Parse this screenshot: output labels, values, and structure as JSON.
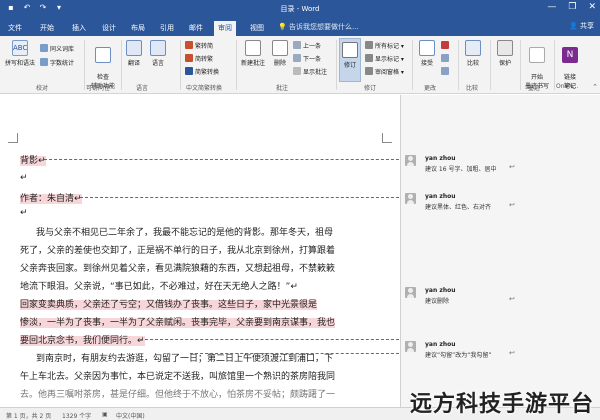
{
  "titlebar": {
    "title": "目录 - Word",
    "controls": [
      "—",
      "❐",
      "✕"
    ]
  },
  "tabs": [
    {
      "label": "文件"
    },
    {
      "label": "开始"
    },
    {
      "label": "插入"
    },
    {
      "label": "设计"
    },
    {
      "label": "布局"
    },
    {
      "label": "引用"
    },
    {
      "label": "邮件"
    },
    {
      "label": "审阅"
    },
    {
      "label": "视图"
    }
  ],
  "tell_me": "告诉我您想要做什么...",
  "share": "共享",
  "ribbon": {
    "proofing": {
      "spelling": "拼写和语法",
      "thesaurus": "同义词库",
      "wordcount": "字数统计",
      "label": "校对"
    },
    "accessibility": {
      "check": "检查\n辅助功能",
      "label": "可访问性"
    },
    "language": {
      "translate": "翻译",
      "language": "语言",
      "label": "语言"
    },
    "chinese": {
      "t2s": "繁转简",
      "s2t": "简转繁",
      "convert": "简繁转换",
      "label": "中文简繁转换"
    },
    "comments": {
      "new": "新建批注",
      "delete": "删除",
      "prev": "上一条",
      "next": "下一条",
      "show": "显示批注",
      "label": "批注"
    },
    "tracking": {
      "track": "修订",
      "markup": "所有标记",
      "show_markup": "显示标记",
      "pane": "审阅窗格",
      "label": "修订"
    },
    "changes": {
      "accept": "接受",
      "label": "更改"
    },
    "compare": {
      "compare": "比较",
      "label": "比较"
    },
    "protect": {
      "protect": "保护",
      "label": ""
    },
    "ink": {
      "hide": "开始\n墨迹书写",
      "label": "墨迹"
    },
    "onenote": {
      "linked": "链接\n笔记",
      "label": "OneN..."
    }
  },
  "document": {
    "lines": [
      "背影↵",
      "↵",
      "作者：朱自清↵",
      "↵",
      "我与父亲不相见已二年余了，我最不能忘记的是他的背影。那年冬天，祖母",
      "死了，父亲的差使也交卸了，正是祸不单行的日子，我从北京到徐州，打算跟着",
      "父亲奔丧回家。到徐州见着父亲，看见满院狼藉的东西，又想起祖母，不禁簌簌",
      "地流下眼泪。父亲说，“事已如此，不必难过，好在天无绝人之路！”↵",
      "回家变卖典质，父亲还了亏空；又借钱办了丧事。这些日子，家中光景很是",
      "惨淡，一半为了丧事，一半为了父亲赋闲。丧事完毕，父亲要到南京谋事，我也",
      "要回北京念书，我们便同行。↵",
      "到南京时，有朋友约去游逛，勾留了一日；第二日上午便须渡江到浦口，下",
      "午上车北去。父亲因为事忙，本已说定不送我，叫旅馆里一个熟识的茶房陪我同",
      "去。他再三嘱咐茶房，甚是仔细。但他终于不放心，怕茶房不妥帖；颇踌躇了一"
    ]
  },
  "comments": [
    {
      "author": "yan zhou",
      "text": "建议 16 号字、加粗、居中"
    },
    {
      "author": "yan zhou",
      "text": "建议黑体、红色、右对齐"
    },
    {
      "author": "yan zhou",
      "text": "建议删除"
    },
    {
      "author": "yan zhou",
      "text": "建议“勾留”改为“我勾留”"
    }
  ],
  "status": {
    "page": "第 1 页，共 2 页",
    "words": "1329 个字",
    "lang": "中文(中国)"
  },
  "watermark": "远方科技手游平台",
  "colors": {
    "accent": "#2b579a",
    "comment_line": "#d43a3a",
    "highlight": "#f7d6d9"
  }
}
